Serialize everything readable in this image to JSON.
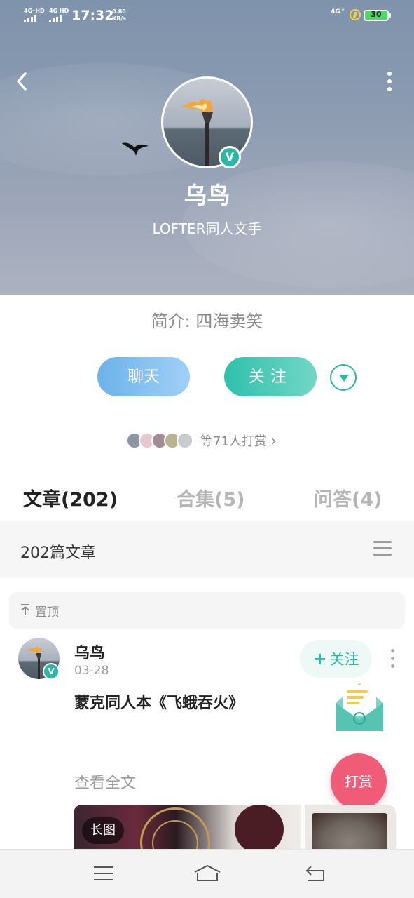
{
  "status_bar": {
    "sim1": "4G⁺HD",
    "sim2": "4G HD",
    "time": "17:32",
    "speed_value": "0.80",
    "speed_unit": "KB/s",
    "network_right": "4G↑",
    "battery": "30"
  },
  "profile": {
    "nickname": "乌鸟",
    "role": "LOFTER同人文手",
    "intro": "简介: 四海卖笑",
    "verified_mark": "V"
  },
  "actions": {
    "chat_label": "聊天",
    "follow_label": "关注"
  },
  "tippers": {
    "text": "等71人打赏",
    "chevron": "›",
    "avatar_colors": [
      "#8c95a3",
      "#e6c7cf",
      "#a38b9a",
      "#b9b48f",
      "#c8cbd0"
    ]
  },
  "tabs": [
    {
      "label": "文章(202)",
      "active": true
    },
    {
      "label": "合集(5)",
      "active": false
    },
    {
      "label": "问答(4)",
      "active": false
    }
  ],
  "list": {
    "count_label": "202篇文章",
    "pinned_label": "置顶"
  },
  "post": {
    "author": "乌鸟",
    "date": "03-28",
    "follow_plus": "+",
    "follow_label": "关注",
    "title": "蒙克同人本《飞蛾吞火》",
    "read_more": "查看全文",
    "tip_label": "打赏",
    "image_tag": "长图"
  },
  "colors": {
    "accent": "#2bb7a5",
    "chat_blue": "#6db2ea",
    "tip_pink": "#f05c78"
  }
}
